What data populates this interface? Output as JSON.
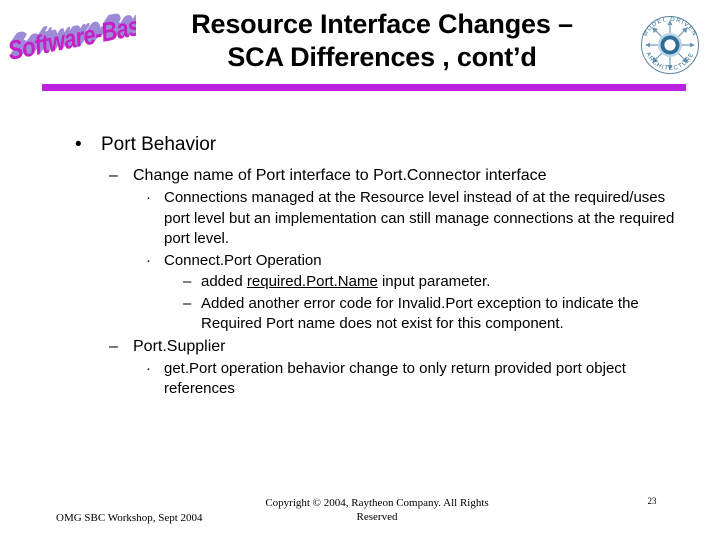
{
  "slide": {
    "background_color": "#FFFFFF",
    "accent_color": "#BB22DD",
    "wordart": {
      "text": "Software-Based",
      "fill_color": "#CC22CC",
      "shadow_color": "#9988DD"
    },
    "title": {
      "line1": "Resource Interface Changes –",
      "line2": "SCA Differences , cont’d"
    },
    "mda_logo": {
      "arc_top_text": "MODEL DRIVEN",
      "arc_bottom_text": "ARCHITECTURE",
      "color": "#4E7C9B",
      "ring_color": "#5E9BBF"
    },
    "bullets": [
      {
        "level": 1,
        "marker": "•",
        "text": "Port Behavior"
      },
      {
        "level": 2,
        "marker": "–",
        "text": "Change name of Port interface to Port.Connector interface"
      },
      {
        "level": 3,
        "marker": "·",
        "text": "Connections managed at the Resource level instead of at the required/uses port level but an implementation can still manage connections at the required port level."
      },
      {
        "level": 3,
        "marker": "·",
        "text": "Connect.Port Operation"
      },
      {
        "level": 4,
        "marker": "–",
        "text_before": "added ",
        "text_underlined": "required.Port.Name",
        "text_after": " input parameter."
      },
      {
        "level": 4,
        "marker": "–",
        "text": "Added another error code for Invalid.Port exception to indicate the Required Port name does not exist for this component."
      },
      {
        "level": 2,
        "marker": "–",
        "text": "Port.Supplier"
      },
      {
        "level": 3,
        "marker": "·",
        "text": "get.Port operation behavior change to only return provided port object references"
      }
    ],
    "footer": {
      "left": "OMG SBC Workshop, Sept 2004",
      "copyright": "Copyright © 2004, Raytheon Company. All Rights Reserved",
      "page_number": "23"
    }
  }
}
